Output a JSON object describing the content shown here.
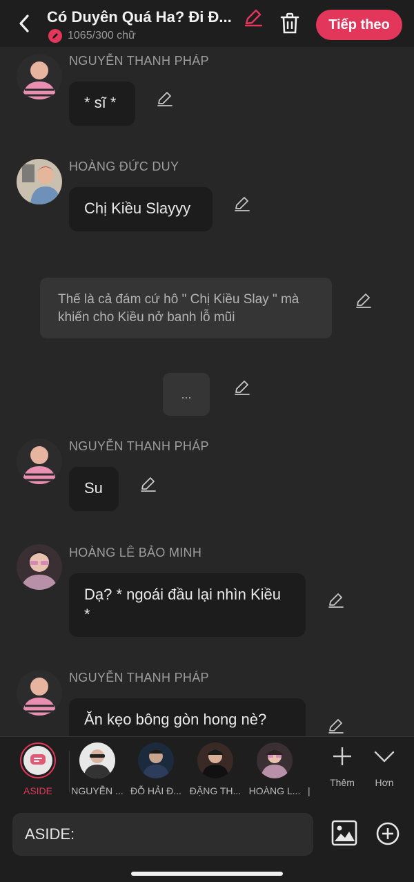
{
  "header": {
    "title": "Có Duyên Quá Ha? Đi Đ...",
    "word_count": "1065/300 chữ",
    "next_label": "Tiếp theo"
  },
  "messages": [
    {
      "name": "NGUYỄN THANH PHÁP",
      "text": "* sĩ *",
      "avatar_color": "#d97aa0"
    },
    {
      "name": "HOÀNG ĐỨC DUY",
      "text": "Chị Kiều Slayyy",
      "avatar_color": "#7f99b3"
    },
    {
      "aside": "Thế là cả đám cứ hô \" Chị Kiều Slay \" mà khiến cho Kiều nở banh lỗ mũi"
    },
    {
      "dots": "..."
    },
    {
      "name": "NGUYỄN THANH PHÁP",
      "text": "Su",
      "avatar_color": "#d97aa0"
    },
    {
      "name": "HOÀNG LÊ BẢO MINH",
      "text": "Dạ? * ngoái đầu lại nhìn Kiều *",
      "avatar_color": "#c7a6b8"
    },
    {
      "name": "NGUYỄN THANH PHÁP",
      "text": "Ăn kẹo bông gòn hong nè?",
      "avatar_color": "#d97aa0"
    }
  ],
  "characters": [
    {
      "label": "ASIDE"
    },
    {
      "label": "NGUYỄN ..."
    },
    {
      "label": "ĐỖ HẢI Đ..."
    },
    {
      "label": "ĐẶNG TH..."
    },
    {
      "label": "HOÀNG L..."
    }
  ],
  "more_label": "Thêm",
  "less_label": "Hơn",
  "input": {
    "value": "ASIDE:"
  },
  "colors": {
    "accent": "#e3365b",
    "background": "#272727",
    "bubble": "#1c1c1c"
  }
}
